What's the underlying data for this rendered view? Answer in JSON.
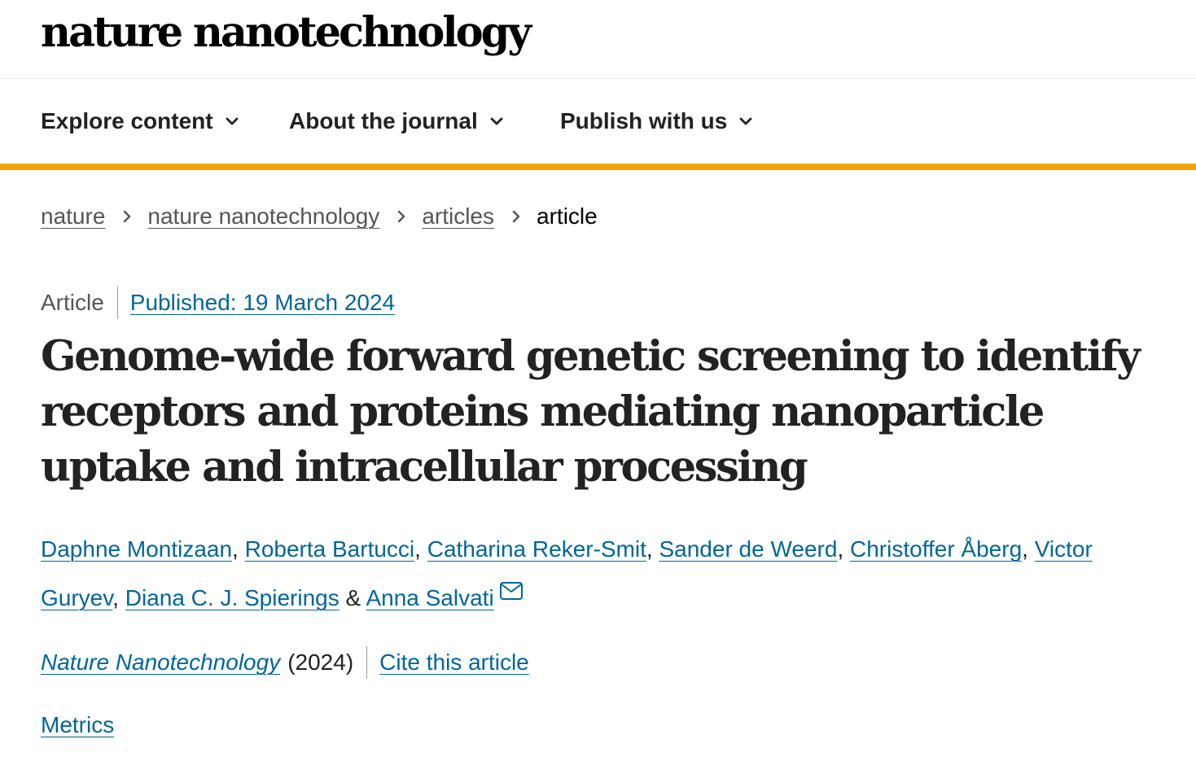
{
  "header": {
    "logo": "nature nanotechnology"
  },
  "nav": {
    "items": [
      {
        "label": "Explore content"
      },
      {
        "label": "About the journal"
      },
      {
        "label": "Publish with us"
      }
    ],
    "accent_color": "#f0a30a"
  },
  "breadcrumb": {
    "items": [
      "nature",
      "nature nanotechnology",
      "articles"
    ],
    "current": "article"
  },
  "article": {
    "type": "Article",
    "published": "Published: 19 March 2024",
    "title": "Genome-wide forward genetic screening to identify receptors and proteins mediating nanoparticle uptake and intracellular processing",
    "authors": [
      "Daphne Montizaan",
      "Roberta Bartucci",
      "Catharina Reker-Smit",
      "Sander de Weerd",
      "Christoffer Åberg",
      "Victor Guryev",
      "Diana C. J. Spierings",
      "Anna Salvati"
    ],
    "author_separator": ", ",
    "author_last_separator": " & ",
    "journal": "Nature Nanotechnology",
    "year": "(2024)",
    "cite_label": "Cite this article",
    "metrics_label": "Metrics",
    "link_color": "#006699"
  },
  "icons": {
    "nav_chevron": "chevron-down-icon",
    "breadcrumb_separator": "chevron-right-icon",
    "corresponding_author": "mail-icon"
  }
}
